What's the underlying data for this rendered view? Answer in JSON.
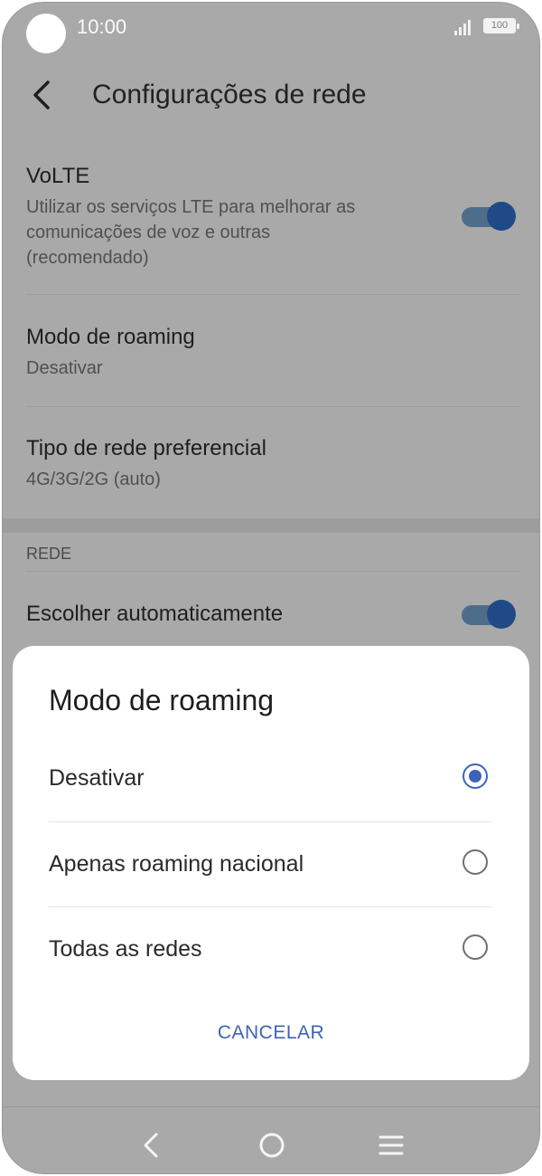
{
  "status_bar": {
    "time": "10:00",
    "battery": "100",
    "icons": [
      "signal-icon",
      "battery-icon"
    ]
  },
  "header": {
    "title": "Configurações de rede",
    "back_icon": "back-arrow-icon"
  },
  "settings": {
    "volte": {
      "title": "VoLTE",
      "subtitle": "Utilizar os serviços LTE para melhorar as comunicações de voz e outras (recomendado)",
      "enabled": true
    },
    "roaming": {
      "title": "Modo de roaming",
      "value": "Desativar"
    },
    "network_type": {
      "title": "Tipo de rede preferencial",
      "value": "4G/3G/2G (auto)"
    },
    "section_label": "REDE",
    "auto_choose": {
      "title": "Escolher automaticamente",
      "enabled": true
    }
  },
  "dialog": {
    "title": "Modo de roaming",
    "options": [
      {
        "label": "Desativar",
        "selected": true
      },
      {
        "label": "Apenas roaming nacional",
        "selected": false
      },
      {
        "label": "Todas as redes",
        "selected": false
      }
    ],
    "cancel_label": "CANCELAR"
  },
  "nav_bar": {
    "icons": [
      "back-icon",
      "home-icon",
      "recents-icon"
    ]
  },
  "colors": {
    "accent": "#3d63b8",
    "toggle_track": "#4d6d8b",
    "toggle_knob": "#1f4a85",
    "scrim": "#a9a9a9"
  }
}
